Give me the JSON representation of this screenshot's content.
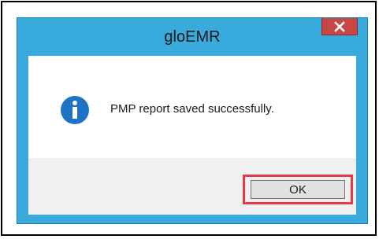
{
  "window": {
    "title": "gloEMR",
    "accent_color": "#38aadc",
    "close_icon": "close-icon",
    "close_color": "#c74646"
  },
  "message": {
    "icon": "info-icon",
    "text": "PMP report saved successfully."
  },
  "buttons": {
    "ok_label": "OK",
    "highlight_color": "#e53a4a"
  }
}
